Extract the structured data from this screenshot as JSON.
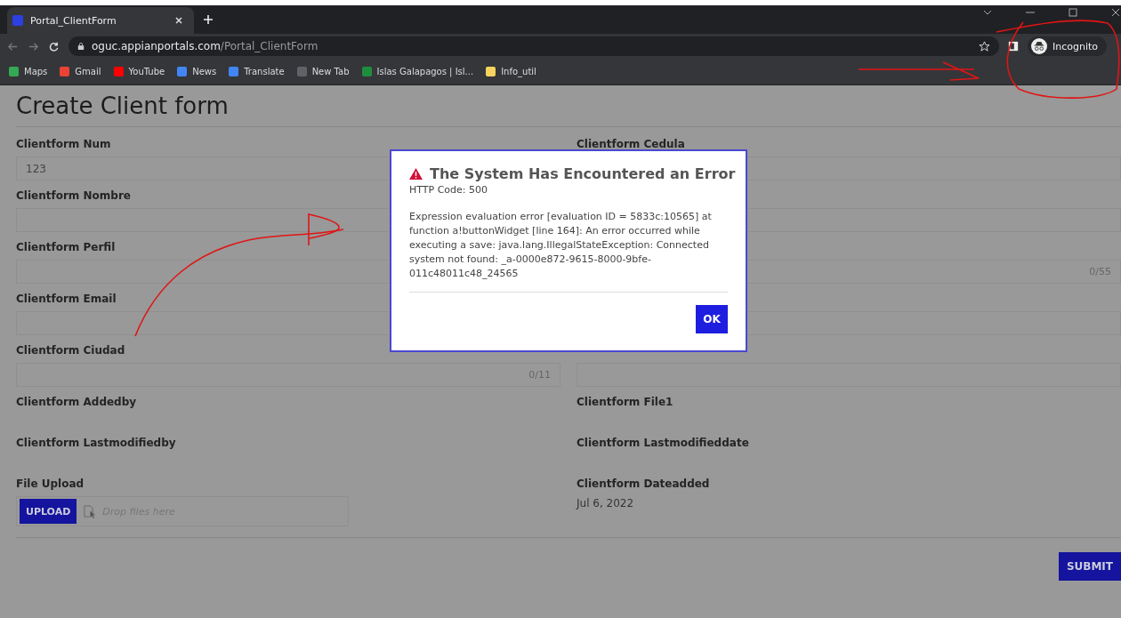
{
  "browser": {
    "tabs": [
      {
        "title": "Portal_ClientForm",
        "selected": true
      }
    ],
    "url_host": "oguc.appianportals.com",
    "url_path": "/Portal_ClientForm",
    "profile": "Incognito",
    "bookmarks": [
      {
        "label": "Maps",
        "color": "#34a853"
      },
      {
        "label": "Gmail",
        "color": "#ea4335"
      },
      {
        "label": "YouTube",
        "color": "#ff0000"
      },
      {
        "label": "News",
        "color": "#4285f4"
      },
      {
        "label": "Translate",
        "color": "#4285f4"
      },
      {
        "label": "New Tab",
        "color": "#5f6368"
      },
      {
        "label": "Islas Galapagos | Isl...",
        "color": "#1e8e3e"
      },
      {
        "label": "Info_util",
        "color": "#f4d35e"
      }
    ]
  },
  "page": {
    "title": "Create Client form",
    "left": [
      {
        "kind": "input",
        "label": "Clientform Num",
        "value": "123"
      },
      {
        "kind": "input",
        "label": "Clientform Nombre"
      },
      {
        "kind": "input",
        "label": "Clientform Perfil"
      },
      {
        "kind": "input",
        "label": "Clientform Email"
      },
      {
        "kind": "input",
        "label": "Clientform Ciudad",
        "counter": "0/11"
      },
      {
        "kind": "readonly",
        "label": "Clientform Addedby"
      },
      {
        "kind": "readonly",
        "label": "Clientform Lastmodifiedby"
      },
      {
        "kind": "upload",
        "label": "File Upload",
        "button": "UPLOAD",
        "placeholder": "Drop files here"
      }
    ],
    "right": [
      {
        "kind": "input",
        "label": "Clientform Cedula"
      },
      {
        "kind": "input"
      },
      {
        "kind": "input",
        "counter": "0/55"
      },
      {
        "kind": "input"
      },
      {
        "kind": "input"
      },
      {
        "kind": "readonly",
        "label": "Clientform File1"
      },
      {
        "kind": "readonly",
        "label": "Clientform Lastmodifieddate"
      },
      {
        "kind": "readonly",
        "label": "Clientform Dateadded",
        "value": "Jul 6, 2022"
      }
    ],
    "submit": "SUBMIT"
  },
  "dialog": {
    "title": "The System Has Encountered an Error",
    "code": "HTTP Code: 500",
    "message": "Expression evaluation error [evaluation ID = 5833c:10565] at function a!buttonWidget [line 164]: An error occurred while executing a save: java.lang.IllegalStateException: Connected system not found: _a-0000e872-9615-8000-9bfe-011c48011c48_24565",
    "button": "OK"
  }
}
